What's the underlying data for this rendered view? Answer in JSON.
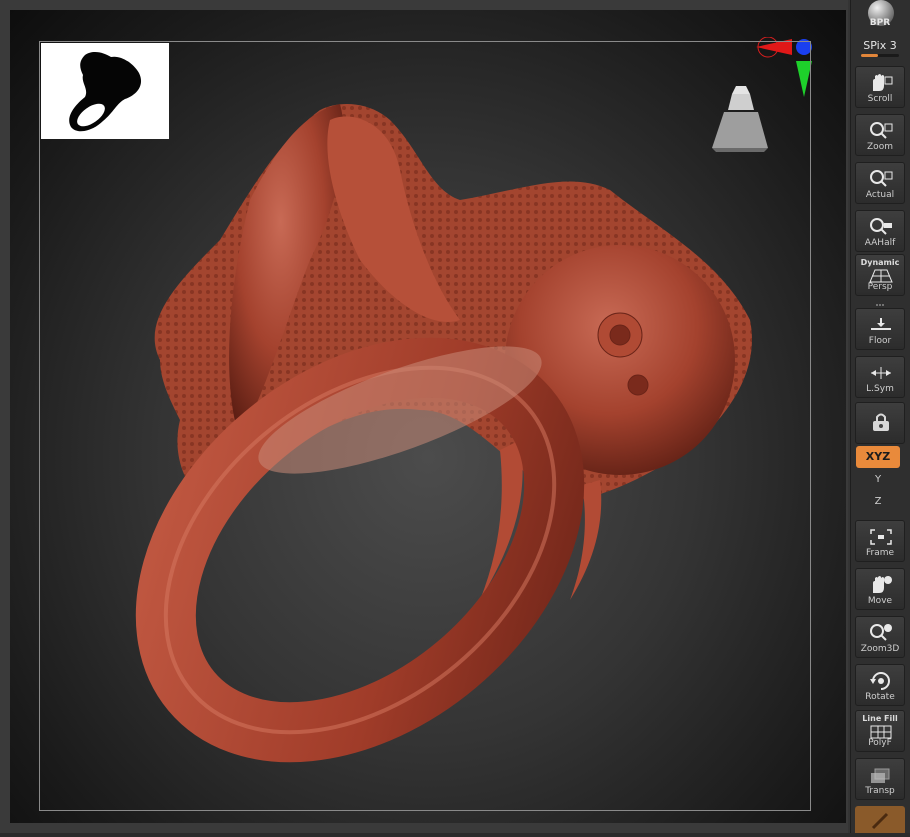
{
  "shelf": {
    "bpr": "BPR",
    "spix": {
      "label": "SPix 3",
      "level": 0.45
    },
    "tools": [
      {
        "id": "scroll",
        "label": "Scroll",
        "icon": "hand-scroll-icon"
      },
      {
        "id": "zoom",
        "label": "Zoom",
        "icon": "zoom-icon"
      },
      {
        "id": "actual",
        "label": "Actual",
        "icon": "actual-size-icon"
      },
      {
        "id": "aahalf",
        "label": "AAHalf",
        "icon": "aahalf-icon"
      },
      {
        "id": "persp",
        "label": "Persp",
        "top": "Dynamic",
        "icon": "perspective-grid-icon"
      },
      {
        "id": "floor",
        "label": "Floor",
        "icon": "floor-icon"
      },
      {
        "id": "lsym",
        "label": "L.Sym",
        "icon": "local-symmetry-icon"
      },
      {
        "id": "lock",
        "label": "",
        "icon": "lock-camera-icon"
      },
      {
        "id": "frame",
        "label": "Frame",
        "icon": "frame-icon"
      },
      {
        "id": "move",
        "label": "Move",
        "icon": "hand-move-icon"
      },
      {
        "id": "zoom3d",
        "label": "Zoom3D",
        "icon": "zoom3d-icon"
      },
      {
        "id": "rotate",
        "label": "Rotate",
        "icon": "rotate-icon"
      },
      {
        "id": "polyf",
        "label": "PolyF",
        "top": "Line Fill",
        "icon": "polyframe-icon"
      },
      {
        "id": "transp",
        "label": "Transp",
        "icon": "transparency-icon"
      }
    ],
    "xyz": "XYZ",
    "rot_y": "Y",
    "rot_z": "Z"
  },
  "colors": {
    "accent": "#e98a3b",
    "model": "#a8452f",
    "background": "#1a1a1a"
  }
}
